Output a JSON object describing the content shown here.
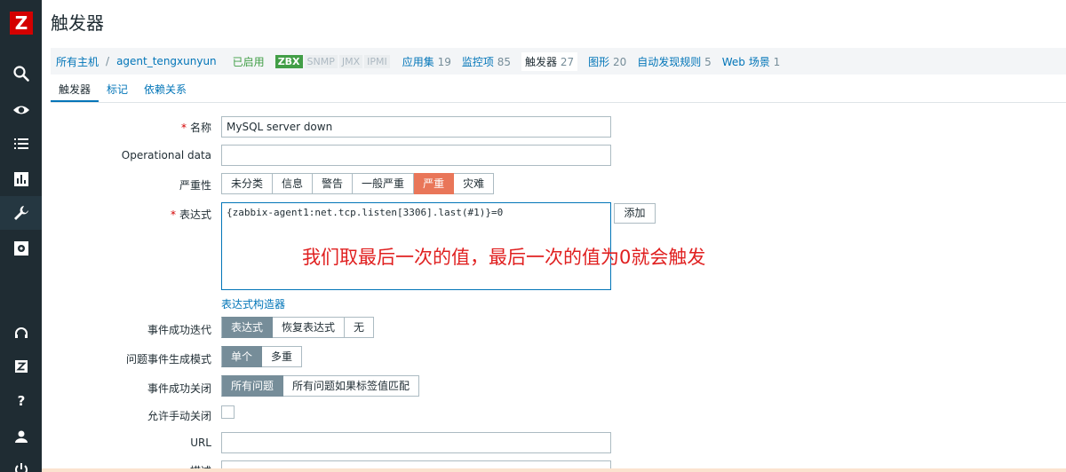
{
  "app": {
    "logo": "Z",
    "page_title": "触发器"
  },
  "sidebar": {
    "icons": [
      "search-icon",
      "eye-icon",
      "list-icon",
      "chart-icon",
      "wrench-icon",
      "gear-icon",
      "headset-icon",
      "z-icon",
      "help-icon",
      "user-icon",
      "power-icon"
    ]
  },
  "hostbar": {
    "all_hosts": "所有主机",
    "separator": "/",
    "host": "agent_tengxunyun",
    "status": "已启用",
    "badges": [
      "ZBX",
      "SNMP",
      "JMX",
      "IPMI"
    ],
    "items": [
      {
        "label": "应用集",
        "count": "19"
      },
      {
        "label": "监控项",
        "count": "85"
      },
      {
        "label": "触发器",
        "count": "27"
      },
      {
        "label": "图形",
        "count": "20"
      },
      {
        "label": "自动发现规则",
        "count": "5"
      },
      {
        "label": "Web 场景",
        "count": "1"
      }
    ]
  },
  "tabs": [
    "触发器",
    "标记",
    "依赖关系"
  ],
  "form": {
    "name_label": "名称",
    "name_value": "MySQL server down",
    "opdata_label": "Operational data",
    "opdata_value": "",
    "severity_label": "严重性",
    "severity_options": [
      "未分类",
      "信息",
      "警告",
      "一般严重",
      "严重",
      "灾难"
    ],
    "severity_selected": 4,
    "expression_label": "表达式",
    "expression_value": "{zabbix-agent1:net.tcp.listen[3306].last(#1)}=0",
    "add_button": "添加",
    "expr_builder_link": "表达式构造器",
    "annotation": "我们取最后一次的值，最后一次的值为0就会触发",
    "ok_event_label": "事件成功迭代",
    "ok_event_options": [
      "表达式",
      "恢复表达式",
      "无"
    ],
    "problem_mode_label": "问题事件生成模式",
    "problem_mode_options": [
      "单个",
      "多重"
    ],
    "ok_close_label": "事件成功关闭",
    "ok_close_options": [
      "所有问题",
      "所有问题如果标签值匹配"
    ],
    "manual_close_label": "允许手动关闭",
    "url_label": "URL",
    "url_value": "",
    "desc_label": "描述"
  },
  "colors": {
    "sidebar": "#1f2c33",
    "link": "#0275b8",
    "severity_high": "#e97659",
    "enabled": "#429e47"
  }
}
